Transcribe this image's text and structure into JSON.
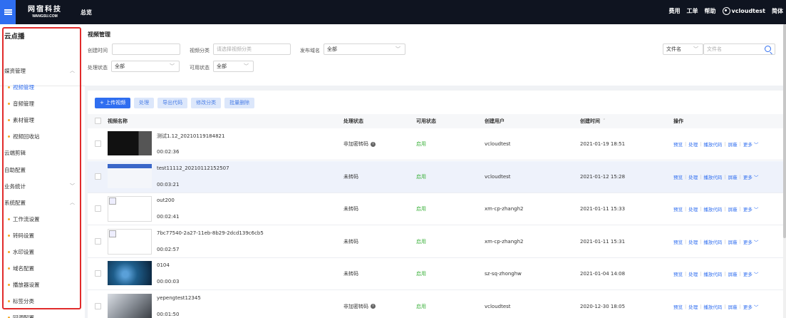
{
  "topbar": {
    "logo_cn": "网宿科技",
    "logo_en": "WANGSU.COM",
    "overview": "总览",
    "links": [
      "费用",
      "工单",
      "帮助"
    ],
    "username": "vcloudtest",
    "lang": "简体"
  },
  "sidebar": {
    "title": "云点播",
    "items": [
      {
        "label": "媒资管理",
        "type": "group",
        "chevron": "up"
      },
      {
        "label": "视频管理",
        "type": "sub",
        "active": true
      },
      {
        "label": "音频管理",
        "type": "sub"
      },
      {
        "label": "素材管理",
        "type": "sub"
      },
      {
        "label": "视频回收站",
        "type": "sub"
      },
      {
        "label": "云端剪辑",
        "type": "group"
      },
      {
        "label": "自助配置",
        "type": "group"
      },
      {
        "label": "业务统计",
        "type": "group",
        "chevron": "down"
      },
      {
        "label": "系统配置",
        "type": "group",
        "chevron": "up"
      },
      {
        "label": "工作流设置",
        "type": "sub"
      },
      {
        "label": "转码设置",
        "type": "sub"
      },
      {
        "label": "水印设置",
        "type": "sub"
      },
      {
        "label": "域名配置",
        "type": "sub"
      },
      {
        "label": "播放器设置",
        "type": "sub"
      },
      {
        "label": "标签分类",
        "type": "sub"
      },
      {
        "label": "回调配置",
        "type": "sub"
      }
    ]
  },
  "filters": {
    "page_title": "视频管理",
    "create_time_label": "创建时间",
    "video_category_label": "视频分类",
    "video_category_placeholder": "请选择视频分类",
    "publish_domain_label": "发布域名",
    "publish_domain_value": "全部",
    "process_status_label": "处理状态",
    "process_status_value": "全部",
    "available_status_label": "可用状态",
    "available_status_value": "全部",
    "search_field_value": "文件名",
    "search_placeholder": "文件名"
  },
  "toolbar": {
    "upload": "+ 上传视频",
    "process": "处理",
    "export": "导出代码",
    "modify_category": "修改分类",
    "batch_delete": "批量删除"
  },
  "table": {
    "headers": {
      "name": "视频名称",
      "process_status": "处理状态",
      "available_status": "可用状态",
      "creator": "创建用户",
      "created_at": "创建时间",
      "ops": "操作"
    },
    "op_labels": [
      "预览",
      "处理",
      "播放代码",
      "屏蔽",
      "更多"
    ],
    "rows": [
      {
        "title": "测试1.12_20210119184821",
        "duration": "00:02:36",
        "status": "非加密转码",
        "info": true,
        "available": "启用",
        "user": "vcloudtest",
        "time": "2021-01-19 18:51",
        "thumb": "dark"
      },
      {
        "title": "test11112_20210112152507",
        "duration": "00:03:21",
        "status": "未转码",
        "available": "启用",
        "user": "vcloudtest",
        "time": "2021-01-12 15:28",
        "thumb": "web"
      },
      {
        "title": "out200",
        "duration": "00:02:41",
        "status": "未转码",
        "available": "启用",
        "user": "xm-cp-zhangh2",
        "time": "2021-01-11 15:33",
        "thumb": "broken"
      },
      {
        "title": "7bc77540-2a27-11eb-8b29-2dcd139c6cb5",
        "duration": "00:02:57",
        "status": "未转码",
        "available": "启用",
        "user": "xm-cp-zhangh2",
        "time": "2021-01-11 15:31",
        "thumb": "broken"
      },
      {
        "title": "0104",
        "duration": "00:00:03",
        "status": "未转码",
        "available": "启用",
        "user": "sz-sq-zhonghw",
        "time": "2021-01-04 14:08",
        "thumb": "blue"
      },
      {
        "title": "yepengtest12345",
        "duration": "00:01:50",
        "status": "非加密转码",
        "info": true,
        "available": "启用",
        "user": "vcloudtest",
        "time": "2020-12-30 18:05",
        "thumb": "office"
      }
    ]
  },
  "colors": {
    "accent": "#2f6ef0",
    "topbar": "#0f1420",
    "enabled": "#3fb33f",
    "highlight_box": "#e12b2b"
  }
}
